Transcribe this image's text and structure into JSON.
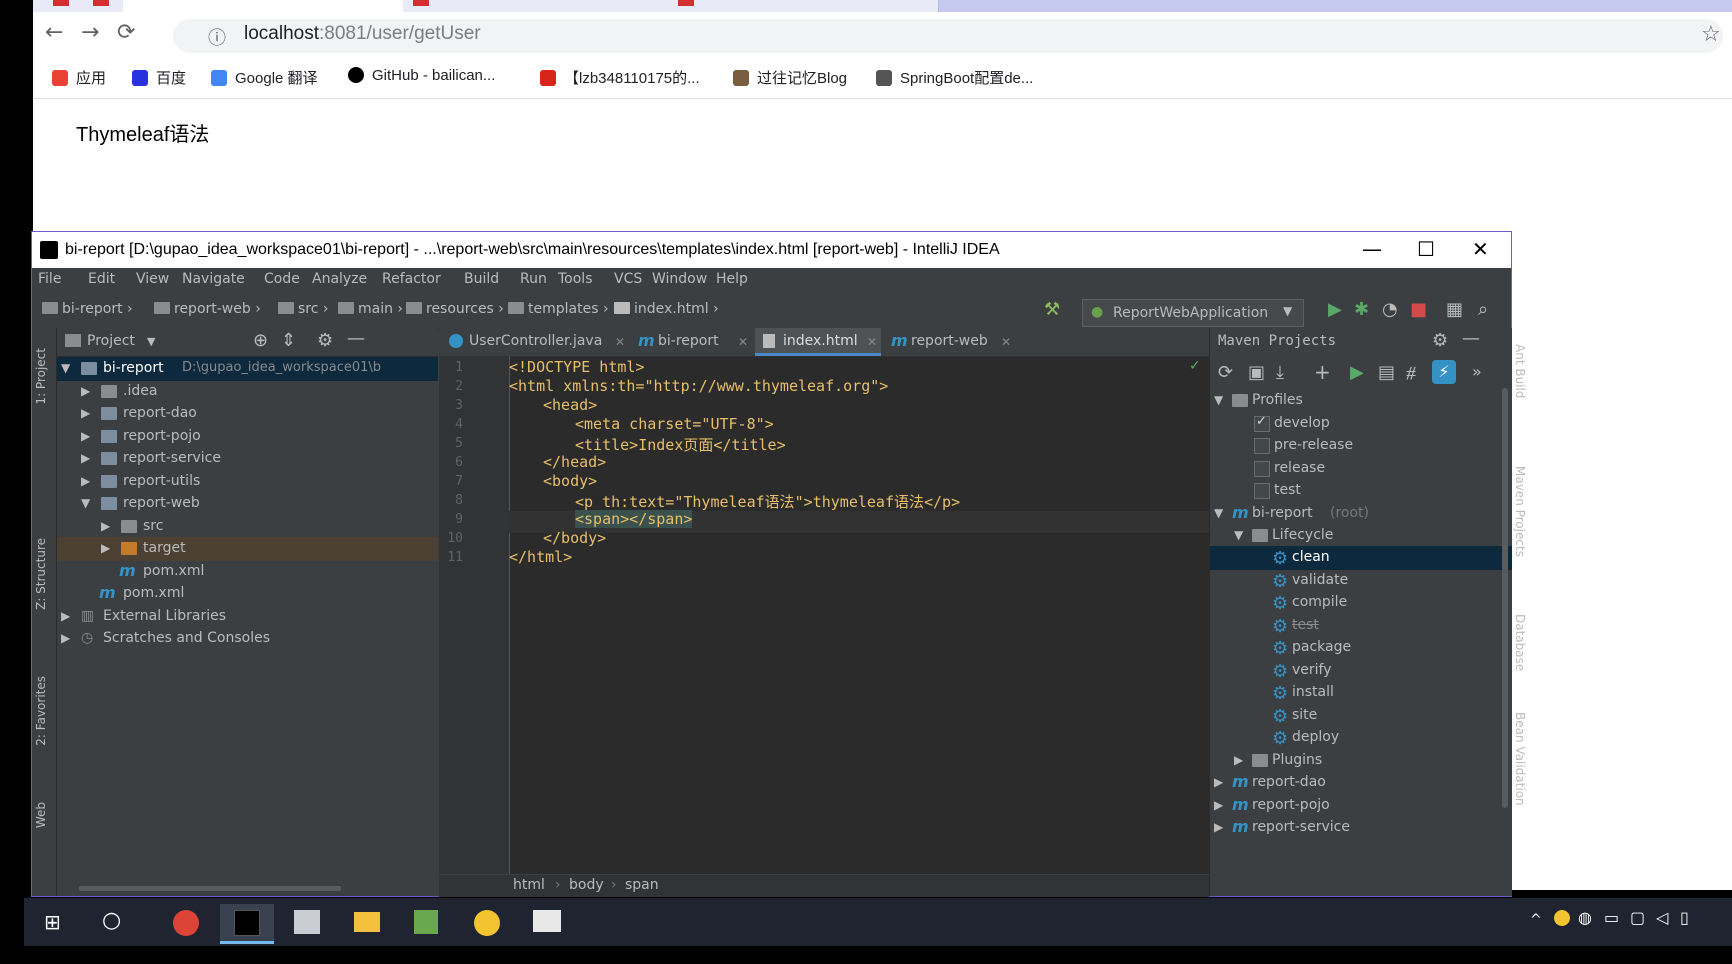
{
  "browser": {
    "url_host": "localhost",
    "url_path": ":8081/user/getUser",
    "bookmarks": [
      {
        "label": "应用",
        "icon": "apps-grid-icon",
        "color": "#ea4335"
      },
      {
        "label": "百度",
        "icon": "baidu-paw-icon",
        "color": "#2932e1"
      },
      {
        "label": "Google 翻译",
        "icon": "google-translate-icon",
        "color": "#4285f4"
      },
      {
        "label": "GitHub - bailican...",
        "icon": "github-icon",
        "color": "#000000"
      },
      {
        "label": "【lzb348110175的...",
        "icon": "csdn-icon",
        "color": "#d9241c"
      },
      {
        "label": "过往记忆Blog",
        "icon": "blog-icon",
        "color": "#7a5c3e"
      },
      {
        "label": "SpringBoot配置de...",
        "icon": "springboot-icon",
        "color": "#333333"
      }
    ],
    "page_text": "Thymeleaf语法"
  },
  "ide": {
    "title": "bi-report [D:\\gupao_idea_workspace01\\bi-report] - ...\\report-web\\src\\main\\resources\\templates\\index.html [report-web] - IntelliJ IDEA",
    "menu": [
      "File",
      "Edit",
      "View",
      "Navigate",
      "Code",
      "Analyze",
      "Refactor",
      "Build",
      "Run",
      "Tools",
      "VCS",
      "Window",
      "Help"
    ],
    "breadcrumbs": [
      "bi-report",
      "report-web",
      "src",
      "main",
      "resources",
      "templates",
      "index.html"
    ],
    "run_config": "ReportWebApplication",
    "left_stripe": [
      "1: Project",
      "Z: Structure",
      "2: Favorites",
      "Web"
    ],
    "right_stripe": [
      "Ant Build",
      "Maven Projects",
      "Database",
      "Bean Validation"
    ],
    "project": {
      "header": "Project",
      "root_label": "bi-report",
      "root_path": "D:\\gupao_idea_workspace01\\b",
      "items": [
        ".idea",
        "report-dao",
        "report-pojo",
        "report-service",
        "report-utils",
        "report-web",
        "src",
        "target",
        "pom.xml",
        "pom.xml",
        "External Libraries",
        "Scratches and Consoles"
      ]
    },
    "tabs": [
      "UserController.java",
      "bi-report",
      "index.html",
      "report-web"
    ],
    "code": {
      "line_numbers": [
        "1",
        "2",
        "3",
        "4",
        "5",
        "6",
        "7",
        "8",
        "9",
        "10",
        "11"
      ],
      "lines": [
        "<!DOCTYPE html>",
        "<html xmlns:th=\"http://www.thymeleaf.org\">",
        "<head>",
        "<meta charset=\"UTF-8\">",
        "<title>Index页面</title>",
        "</head>",
        "<body>",
        "<p th:text=\"Thymeleaf语法\">thymeleaf语法</p>",
        "<span></span>",
        "</body>",
        "</html>"
      ]
    },
    "editor_breadcrumb": [
      "html",
      "body",
      "span"
    ],
    "maven": {
      "header": "Maven Projects",
      "profiles_label": "Profiles",
      "profiles": [
        {
          "name": "develop",
          "checked": true
        },
        {
          "name": "pre-release",
          "checked": false
        },
        {
          "name": "release",
          "checked": false
        },
        {
          "name": "test",
          "checked": false
        }
      ],
      "root_label": "bi-report",
      "root_suffix": "(root)",
      "lifecycle_label": "Lifecycle",
      "lifecycle": [
        "clean",
        "validate",
        "compile",
        "test",
        "package",
        "verify",
        "install",
        "site",
        "deploy"
      ],
      "plugins_label": "Plugins",
      "modules": [
        "report-dao",
        "report-pojo",
        "report-service"
      ]
    }
  },
  "colors": {
    "accent": "#3592c4",
    "selection": "#0d293e",
    "tag": "#e8bf6a",
    "string": "#a5c25c"
  }
}
